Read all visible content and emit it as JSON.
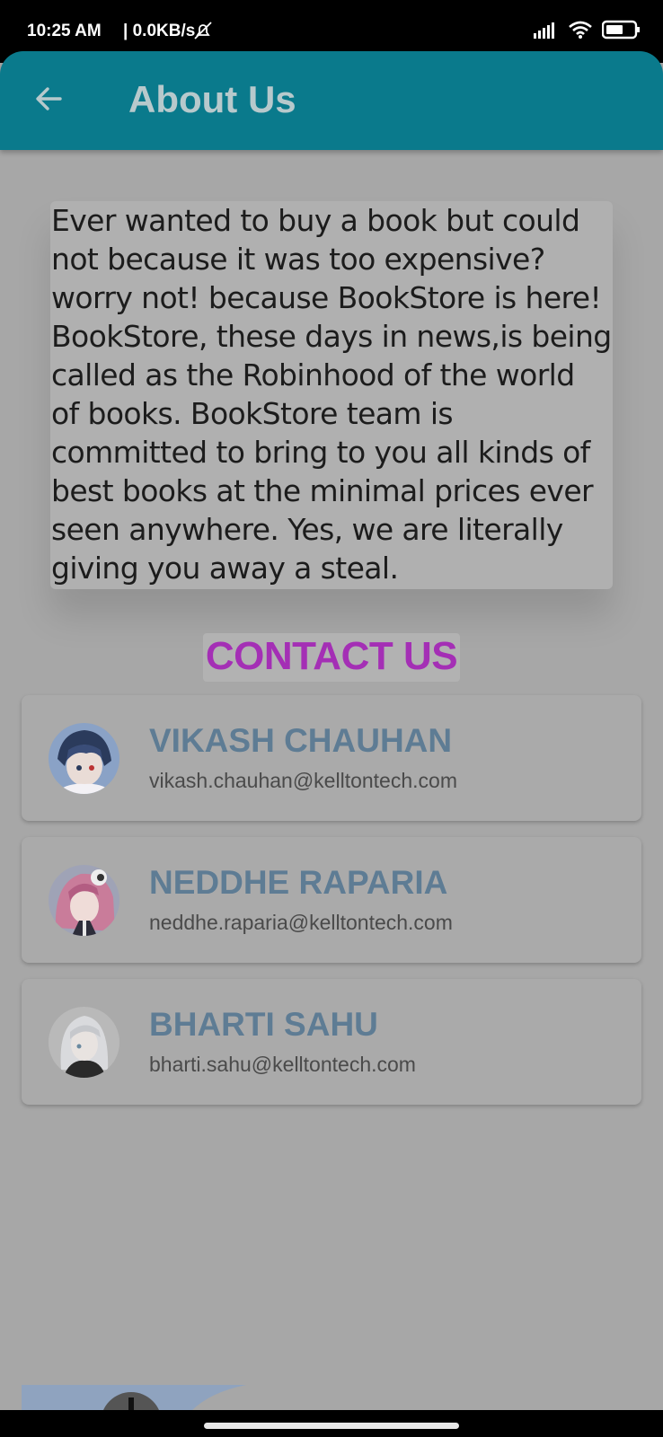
{
  "status": {
    "time": "10:25 AM",
    "network_speed": "| 0.0KB/s",
    "battery_icon": "battery-icon",
    "wifi_icon": "wifi-icon",
    "signal_icon": "signal-icon"
  },
  "app_bar": {
    "title": "About Us",
    "back_icon": "back-arrow-icon",
    "color": "#0a7a8c"
  },
  "about": {
    "text": "Ever wanted to buy a book but could\nnot because it was too expensive?\nworry not! because BookStore is here!\nBookStore, these days in news,is being\ncalled as the Robinhood of the world\nof books. BookStore team is\ncommitted to bring to you all kinds of\nbest books at the minimal prices ever\nseen anywhere. Yes, we are literally\ngiving you away a steal."
  },
  "contact": {
    "heading": "CONTACT US",
    "heading_color": "#a42fb5",
    "people": [
      {
        "name": "VIKASH CHAUHAN",
        "email": "vikash.chauhan@kelltontech.com"
      },
      {
        "name": "NEDDHE RAPARIA",
        "email": "neddhe.raparia@kelltontech.com"
      },
      {
        "name": "BHARTI SAHU",
        "email": "bharti.sahu@kelltontech.com"
      }
    ]
  }
}
